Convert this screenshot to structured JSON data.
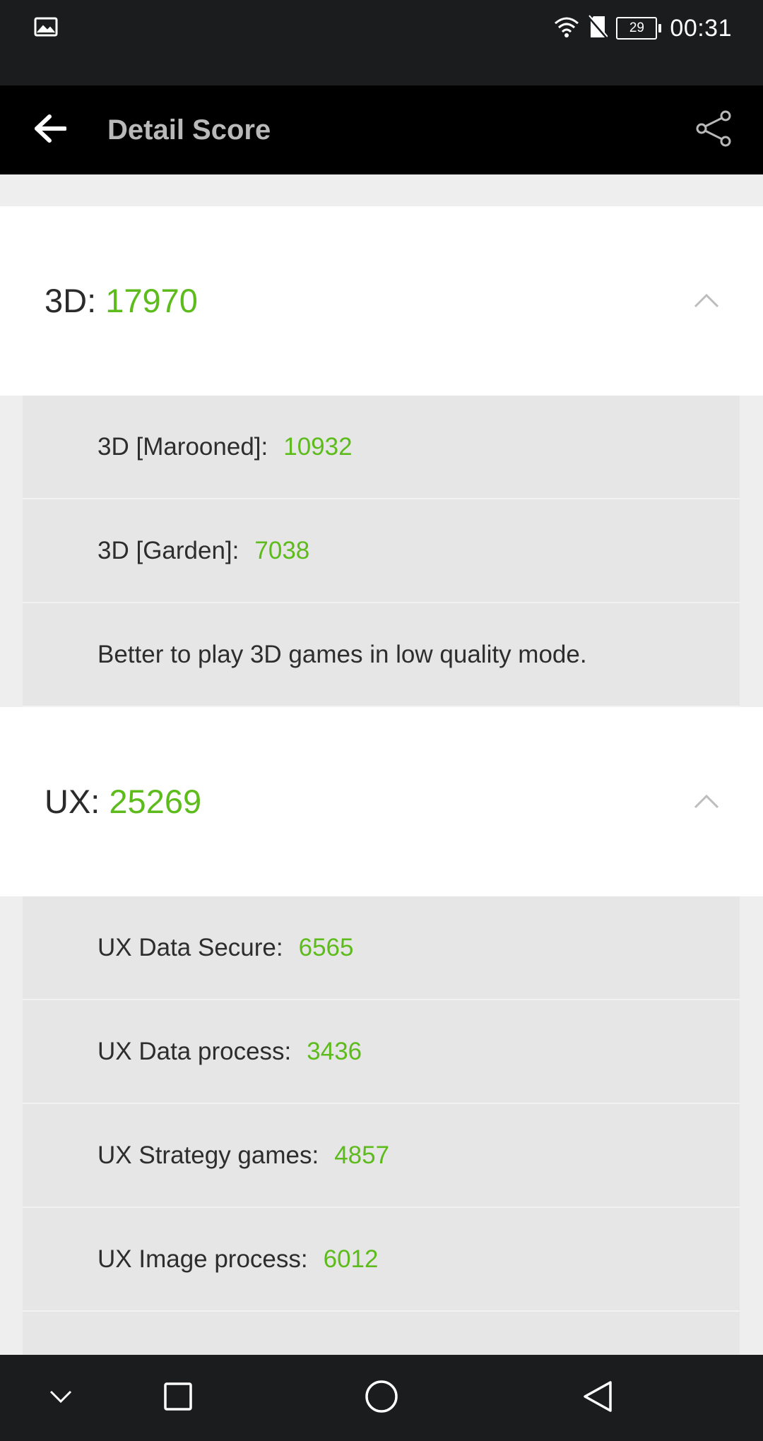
{
  "status_bar": {
    "time": "00:31",
    "battery_level": "29",
    "icons": [
      "image-icon",
      "wifi-icon",
      "no-sim-icon",
      "battery-icon"
    ]
  },
  "app_bar": {
    "title": "Detail Score",
    "icons": [
      "back-arrow-icon",
      "share-icon"
    ]
  },
  "sections": [
    {
      "label": "3D:",
      "score": "17970",
      "items": [
        {
          "label": "3D [Marooned]:",
          "value": "10932"
        },
        {
          "label": "3D [Garden]:",
          "value": "7038"
        },
        {
          "label": "Better to play 3D games in low quality mode.",
          "value": ""
        }
      ]
    },
    {
      "label": "UX:",
      "score": "25269",
      "items": [
        {
          "label": "UX Data Secure:",
          "value": "6565"
        },
        {
          "label": "UX Data process:",
          "value": "3436"
        },
        {
          "label": "UX Strategy games:",
          "value": "4857"
        },
        {
          "label": "UX Image process:",
          "value": "6012"
        }
      ]
    }
  ],
  "nav_bar": {
    "icons": [
      "chevron-down-icon",
      "recents-square-icon",
      "home-circle-icon",
      "back-triangle-icon"
    ]
  },
  "colors": {
    "accent_green": "#5dbb1c",
    "status_bar_bg": "#1b1c1e",
    "app_bar_bg": "#000000",
    "title_gray": "#b9b9b9"
  }
}
